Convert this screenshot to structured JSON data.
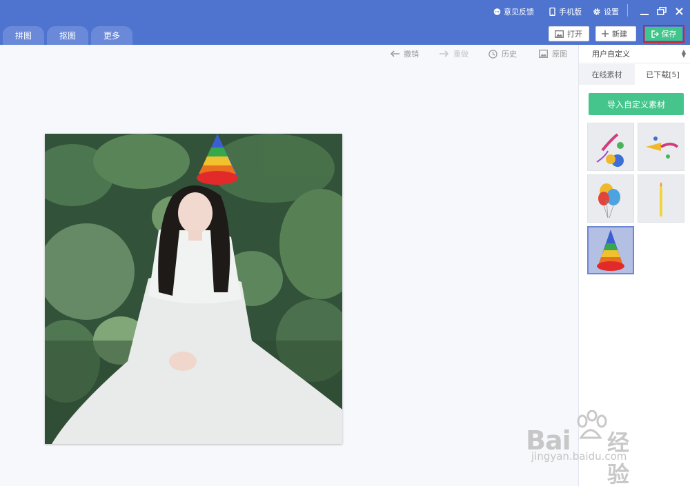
{
  "titlebar": {
    "feedback": "意见反馈",
    "mobile": "手机版",
    "settings": "设置",
    "tabs": [
      "拼图",
      "抠图",
      "更多"
    ],
    "open": "打开",
    "new": "新建",
    "save": "保存"
  },
  "toolbar": {
    "undo": "撤销",
    "redo": "重做",
    "history": "历史",
    "original": "原图"
  },
  "panel": {
    "dropdown_value": "用户自定义",
    "tab_online": "在线素材",
    "tab_downloaded": "已下载[5]",
    "import_button": "导入自定义素材",
    "thumbnails": [
      "party-horn-sticker",
      "party-blower-sticker",
      "balloons-sticker",
      "candle-sticker",
      "party-hat-sticker"
    ]
  },
  "watermark": {
    "brand": "Bai",
    "brand_cn": "经验",
    "url": "jingyan.baidu.com"
  },
  "colors": {
    "titlebar": "#4f74cf",
    "save": "#40c58a",
    "highlight": "#d62323"
  }
}
